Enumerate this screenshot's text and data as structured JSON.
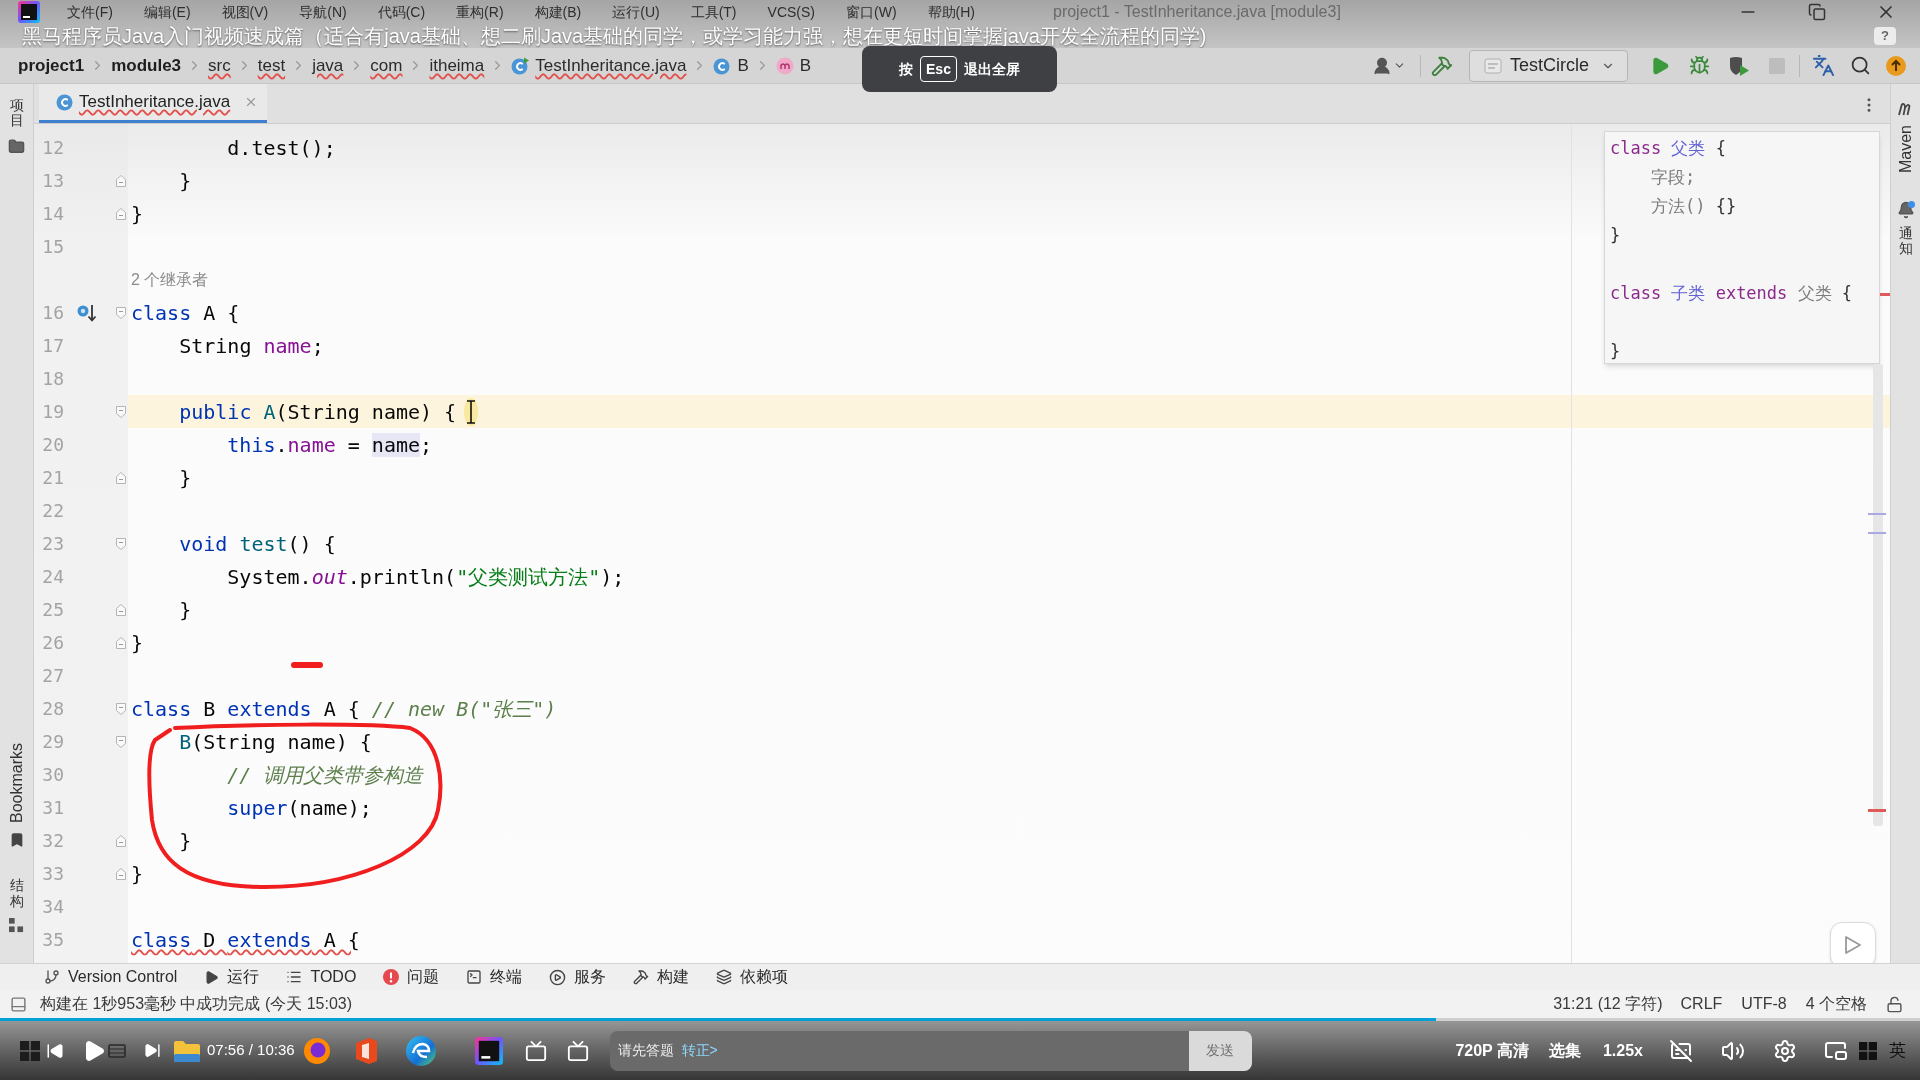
{
  "title_bar": {
    "menu": [
      "文件(F)",
      "编辑(E)",
      "视图(V)",
      "导航(N)",
      "代码(C)",
      "重构(R)",
      "构建(B)",
      "运行(U)",
      "工具(T)",
      "VCS(S)",
      "窗口(W)",
      "帮助(H)"
    ],
    "window_title": "project1 - TestInheritance.java [module3]"
  },
  "video_title": "黑马程序员Java入门视频速成篇（适合有java基础、想二刷Java基础的同学，或学习能力强，想在更短时间掌握java开发全流程的同学)",
  "help_badge": "?",
  "navigation_bar": {
    "breadcrumbs": [
      {
        "label": "project1",
        "kind": "root",
        "squiggle": false
      },
      {
        "label": "module3",
        "kind": "root",
        "squiggle": false
      },
      {
        "label": "src",
        "kind": "folder",
        "squiggle": true
      },
      {
        "label": "test",
        "kind": "folder",
        "squiggle": true
      },
      {
        "label": "java",
        "kind": "folder",
        "squiggle": true
      },
      {
        "label": "com",
        "kind": "folder",
        "squiggle": true
      },
      {
        "label": "itheima",
        "kind": "folder",
        "squiggle": true
      },
      {
        "label": "TestInheritance.java",
        "kind": "file",
        "squiggle": true
      },
      {
        "label": "B",
        "kind": "class",
        "squiggle": false
      },
      {
        "label": "B",
        "kind": "method",
        "squiggle": false
      }
    ],
    "run_config": "TestCircle"
  },
  "fullscreen_hint": {
    "prefix": "按",
    "key": "Esc",
    "suffix": "退出全屏"
  },
  "left_tools": [
    {
      "label": "项目",
      "kind": "project"
    },
    {
      "label": "Bookmarks",
      "kind": "bookmarks"
    },
    {
      "label": "结构",
      "kind": "structure"
    }
  ],
  "tabs": [
    {
      "label": "TestInheritance.java",
      "selected": true,
      "squiggle": true
    }
  ],
  "editor": {
    "lines": [
      {
        "kind": "code",
        "number": "12",
        "current": false,
        "error": false,
        "tokens": [
          {
            "kind": "plain",
            "text": "        d.test();"
          }
        ]
      },
      {
        "kind": "code",
        "number": "13",
        "gutter": [
          {
            "kind": "foldend"
          }
        ],
        "current": false,
        "error": false,
        "tokens": [
          {
            "kind": "plain",
            "text": "    }"
          }
        ]
      },
      {
        "kind": "code",
        "number": "14",
        "gutter": [
          {
            "kind": "foldend"
          }
        ],
        "current": false,
        "error": false,
        "tokens": [
          {
            "kind": "plain",
            "text": "}"
          }
        ]
      },
      {
        "kind": "code",
        "number": "15",
        "current": false
      },
      {
        "kind": "hint",
        "text": "2 个继承者"
      },
      {
        "kind": "code",
        "number": "16",
        "gutter": [
          {
            "kind": "inheritors"
          },
          {
            "kind": "foldstart"
          }
        ],
        "current": false,
        "error": false,
        "tokens": [
          {
            "kind": "keyword",
            "text": "class"
          },
          {
            "kind": "plain",
            "text": " A {"
          }
        ]
      },
      {
        "kind": "code",
        "number": "17",
        "current": false,
        "error": false,
        "tokens": [
          {
            "kind": "plain",
            "text": "    String "
          },
          {
            "kind": "field",
            "text": "name"
          },
          {
            "kind": "plain",
            "text": ";"
          }
        ]
      },
      {
        "kind": "code",
        "number": "18",
        "current": false
      },
      {
        "kind": "code",
        "number": "19",
        "gutter": [
          {
            "kind": "foldstart"
          }
        ],
        "current": true,
        "error": false,
        "tokens": [
          {
            "kind": "keyword",
            "text": "    public "
          },
          {
            "kind": "decl",
            "text": "A"
          },
          {
            "kind": "plain",
            "text": "(String name) {"
          }
        ]
      },
      {
        "kind": "code",
        "number": "20",
        "current": false,
        "error": false,
        "tokens": [
          {
            "kind": "keyword",
            "text": "        this"
          },
          {
            "kind": "plain",
            "text": "."
          },
          {
            "kind": "field",
            "text": "name"
          },
          {
            "kind": "plain",
            "text": " = "
          },
          {
            "kind": "usage",
            "text": "name"
          },
          {
            "kind": "plain",
            "text": ";"
          }
        ]
      },
      {
        "kind": "code",
        "number": "21",
        "gutter": [
          {
            "kind": "foldend"
          }
        ],
        "current": false,
        "error": false,
        "tokens": [
          {
            "kind": "plain",
            "text": "    }"
          }
        ]
      },
      {
        "kind": "code",
        "number": "22",
        "current": false
      },
      {
        "kind": "code",
        "number": "23",
        "gutter": [
          {
            "kind": "foldstart"
          }
        ],
        "current": false,
        "error": false,
        "tokens": [
          {
            "kind": "keyword",
            "text": "    void "
          },
          {
            "kind": "decl",
            "text": "test"
          },
          {
            "kind": "plain",
            "text": "() {"
          }
        ]
      },
      {
        "kind": "code",
        "number": "24",
        "current": false,
        "error": false,
        "tokens": [
          {
            "kind": "plain",
            "text": "        System."
          },
          {
            "kind": "static",
            "text": "out"
          },
          {
            "kind": "plain",
            "text": ".println("
          },
          {
            "kind": "string",
            "text": "\"父类测试方法\""
          },
          {
            "kind": "plain",
            "text": ");"
          }
        ]
      },
      {
        "kind": "code",
        "number": "25",
        "gutter": [
          {
            "kind": "foldend"
          }
        ],
        "current": false,
        "error": false,
        "tokens": [
          {
            "kind": "plain",
            "text": "    }"
          }
        ]
      },
      {
        "kind": "code",
        "number": "26",
        "gutter": [
          {
            "kind": "foldend"
          }
        ],
        "current": false,
        "error": false,
        "tokens": [
          {
            "kind": "plain",
            "text": "}"
          }
        ]
      },
      {
        "kind": "code",
        "number": "27",
        "current": false
      },
      {
        "kind": "code",
        "number": "28",
        "gutter": [
          {
            "kind": "foldstart"
          }
        ],
        "current": false,
        "error": false,
        "tokens": [
          {
            "kind": "keyword",
            "text": "class"
          },
          {
            "kind": "plain",
            "text": " B "
          },
          {
            "kind": "keyword",
            "text": "extends"
          },
          {
            "kind": "plain",
            "text": " A { "
          },
          {
            "kind": "comment",
            "text": "// new B(\"张三\")"
          }
        ]
      },
      {
        "kind": "code",
        "number": "29",
        "gutter": [
          {
            "kind": "foldstart"
          }
        ],
        "current": false,
        "error": false,
        "tokens": [
          {
            "kind": "decl",
            "text": "    B"
          },
          {
            "kind": "plain",
            "text": "(String name) {"
          }
        ]
      },
      {
        "kind": "code",
        "number": "30",
        "current": false,
        "error": false,
        "tokens": [
          {
            "kind": "comment",
            "text": "        // 调用父类带参构造"
          }
        ]
      },
      {
        "kind": "code",
        "number": "31",
        "current": false,
        "error": false,
        "tokens": [
          {
            "kind": "keyword",
            "text": "        super"
          },
          {
            "kind": "plain",
            "text": "(name);"
          }
        ]
      },
      {
        "kind": "code",
        "number": "32",
        "gutter": [
          {
            "kind": "foldend"
          }
        ],
        "current": false,
        "error": false,
        "tokens": [
          {
            "kind": "plain",
            "text": "    }"
          }
        ]
      },
      {
        "kind": "code",
        "number": "33",
        "gutter": [
          {
            "kind": "foldend"
          }
        ],
        "current": false,
        "error": false,
        "tokens": [
          {
            "kind": "plain",
            "text": "}"
          }
        ]
      },
      {
        "kind": "code",
        "number": "34",
        "current": false
      },
      {
        "kind": "code",
        "number": "35",
        "current": false,
        "error": true,
        "tokens": [
          {
            "kind": "keyword",
            "text": "class"
          },
          {
            "kind": "plain",
            "text": " D "
          },
          {
            "kind": "keyword",
            "text": "extends"
          },
          {
            "kind": "plain",
            "text": " A {"
          }
        ]
      }
    ],
    "preview": {
      "lines": [
        {
          "kind": "code",
          "tokens": [
            {
              "kind": "keyword",
              "text": "class "
            },
            {
              "kind": "name",
              "text": "父类"
            },
            {
              "kind": "plain",
              "text": " {"
            }
          ]
        },
        {
          "kind": "code",
          "tokens": [
            {
              "kind": "muted",
              "text": "    字段;"
            }
          ]
        },
        {
          "kind": "code",
          "tokens": [
            {
              "kind": "muted",
              "text": "    方法()"
            },
            {
              "kind": "plain",
              "text": " {}"
            }
          ]
        },
        {
          "kind": "code",
          "tokens": [
            {
              "kind": "plain",
              "text": "}"
            }
          ]
        },
        {
          "kind": "blank"
        },
        {
          "kind": "code",
          "tokens": [
            {
              "kind": "keyword",
              "text": "class "
            },
            {
              "kind": "name",
              "text": "子类"
            },
            {
              "kind": "keyword",
              "text": " extends "
            },
            {
              "kind": "muted",
              "text": "父类"
            },
            {
              "kind": "plain",
              "text": " {"
            }
          ]
        },
        {
          "kind": "blank"
        },
        {
          "kind": "code",
          "tokens": [
            {
              "kind": "plain",
              "text": "}"
            }
          ]
        }
      ]
    }
  },
  "right_tools": [
    {
      "label": "Maven",
      "kind": "maven"
    },
    {
      "label": "通知",
      "kind": "notifications"
    }
  ],
  "tool_windows": [
    {
      "label": "Version Control",
      "kind": "vcs"
    },
    {
      "label": "运行",
      "kind": "run"
    },
    {
      "label": "TODO",
      "kind": "todo"
    },
    {
      "label": "问题",
      "kind": "problems"
    },
    {
      "label": "终端",
      "kind": "terminal"
    },
    {
      "label": "服务",
      "kind": "services"
    },
    {
      "label": "构建",
      "kind": "build"
    },
    {
      "label": "依赖项",
      "kind": "dependencies"
    }
  ],
  "status_bar": {
    "message": "构建在 1秒953毫秒 中成功完成 (今天 15:03)",
    "position": "31:21 (12 字符)",
    "line_separator": "CRLF",
    "encoding": "UTF-8",
    "indent": "4 个空格"
  },
  "player": {
    "progress": {
      "level": 0.748
    },
    "time": "07:56 / 10:36",
    "comment_box": {
      "placeholder": "请先答题",
      "link": "转正>"
    },
    "send": "发送",
    "quality": "720P 高清",
    "episodes": "选集",
    "speed": "1.25x"
  },
  "taskbar": {
    "ime": "英"
  }
}
